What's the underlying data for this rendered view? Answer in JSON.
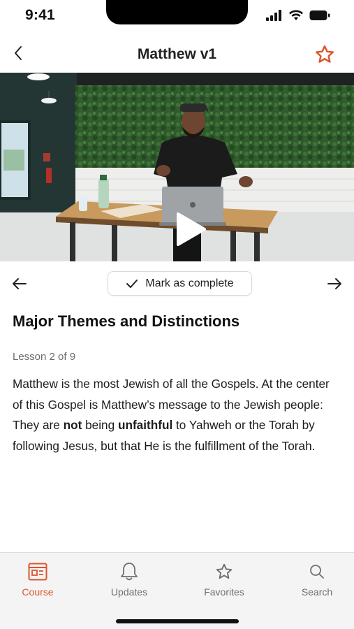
{
  "status_bar": {
    "time": "9:41"
  },
  "header": {
    "title": "Matthew v1",
    "back_icon": "chevron-left-icon",
    "favorite_icon": "star-outline-icon"
  },
  "video": {
    "play_icon": "play-icon"
  },
  "lesson_nav": {
    "prev_icon": "arrow-left-icon",
    "next_icon": "arrow-right-icon",
    "complete_label": "Mark as complete",
    "complete_icon": "checkmark-icon"
  },
  "lesson": {
    "title": "Major Themes and Distinctions",
    "count": "Lesson 2 of 9",
    "body": {
      "p1": "Matthew is the most Jewish of all the Gospels. At the center of this Gospel is Matthew’s message to the Jewish people: They are ",
      "b1": "not",
      "p2": " being ",
      "b2": "unfaithful",
      "p3": " to Yahweh or the Torah by following Jesus, but that He is the fulfillment of the Torah."
    }
  },
  "tabs": [
    {
      "label": "Course",
      "icon": "course-icon",
      "active": true
    },
    {
      "label": "Updates",
      "icon": "bell-icon",
      "active": false
    },
    {
      "label": "Favorites",
      "icon": "star-icon",
      "active": false
    },
    {
      "label": "Search",
      "icon": "search-icon",
      "active": false
    }
  ],
  "colors": {
    "accent": "#e0542d",
    "tab_inactive": "#6f6f6f",
    "tab_bar_bg": "#f4f4f4"
  }
}
